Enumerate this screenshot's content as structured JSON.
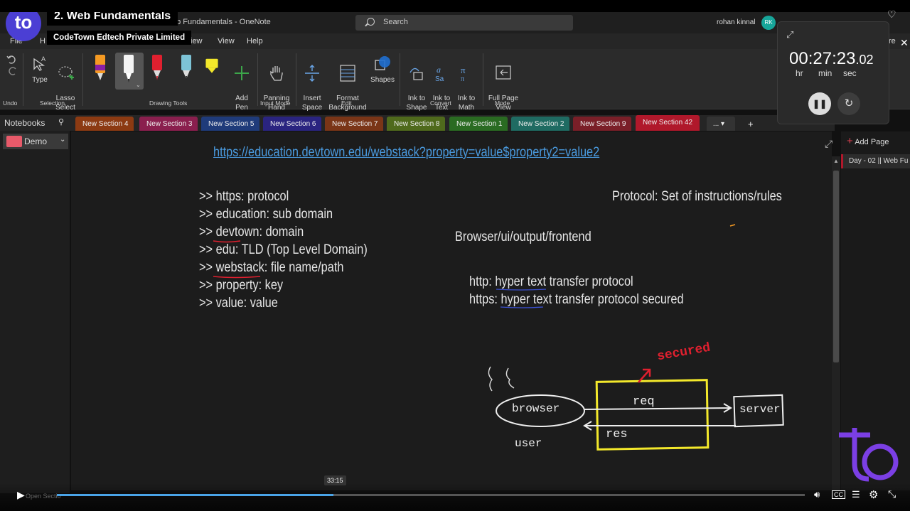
{
  "course_overlay": {
    "logo": "to",
    "title": "2. Web Fundamentals",
    "subtitle": "CodeTown Edtech Private Limited"
  },
  "window": {
    "title": "2. Web Fundamentals - OneNote",
    "title_visible": "eb Fundamentals  -  OneNote",
    "user": "rohan kinnal",
    "avatar": "RK"
  },
  "search": {
    "placeholder": "Search"
  },
  "menu": {
    "file": "File",
    "h": "H",
    "view1": "iew",
    "view2": "View",
    "help": "Help",
    "re": "re"
  },
  "ribbon": {
    "type": "Type",
    "lasso": "Lasso\nSelect",
    "add_pen": "Add\nPen",
    "panning": "Panning\nHand",
    "insert_space": "Insert\nSpace",
    "format_bg": "Format\nBackground",
    "shapes": "Shapes",
    "ink_shape": "Ink to\nShape",
    "ink_text": "Ink to\nText",
    "ink_math": "Ink to\nMath",
    "full_page": "Full Page\nView",
    "groups": {
      "undo": "Undo",
      "selection": "Selection",
      "drawing": "Drawing Tools",
      "input": "Input Mode",
      "edit": "Edit",
      "convert": "Convert",
      "mode": "Mode"
    }
  },
  "notebooks": {
    "header": "Notebooks",
    "current": "Demo"
  },
  "sections": [
    {
      "label": "New Section 4",
      "color": "#8c3a12"
    },
    {
      "label": "New Section 3",
      "color": "#8a1f4e"
    },
    {
      "label": "New Section 5",
      "color": "#1f3b7a"
    },
    {
      "label": "New Section 6",
      "color": "#2a2480"
    },
    {
      "label": "New Section 7",
      "color": "#7a3517"
    },
    {
      "label": "New Section 8",
      "color": "#4f6a1c"
    },
    {
      "label": "New Section 1",
      "color": "#2a6b22"
    },
    {
      "label": "New Section 2",
      "color": "#1f6b62"
    },
    {
      "label": "New Section 9",
      "color": "#7a1f28"
    },
    {
      "label": "New Section 42",
      "color": "#b0182b"
    }
  ],
  "section_more": "...",
  "section_add": "+",
  "page": {
    "url": "https://education.devtown.edu/webstack?property=value$property2=value2",
    "list": [
      ">> https: protocol",
      ">> education: sub domain",
      ">> devtown: domain",
      ">> edu: TLD (Top Level Domain)",
      ">> webstack: file name/path",
      ">> property: key",
      ">> value: value"
    ],
    "protocol": "Protocol:  Set of instructions/rules",
    "browser": "Browser/ui/output/frontend",
    "http": "http: hyper text transfer protocol",
    "https": "https: hyper text transfer protocol  secured",
    "diagram": {
      "secured": "secured",
      "browser": "browser",
      "req": "req",
      "res": "res",
      "server": "server",
      "user": "user"
    }
  },
  "right_pane": {
    "add_page": "Add Page",
    "page": "Day - 02 || Web Fu"
  },
  "timer": {
    "hours": "00",
    "minutes": "27",
    "seconds": "23",
    "fraction": ".02",
    "hr": "hr",
    "min": "min",
    "sec": "sec"
  },
  "player": {
    "tooltip": "33:15",
    "progress": 0.37,
    "bottom_text": "Open Sectio"
  },
  "colors": {
    "accent": "#4b3fd4",
    "active_section": "#b0182b",
    "link": "#4a9be0",
    "yellow": "#f3e82b",
    "red": "#e0202f"
  }
}
